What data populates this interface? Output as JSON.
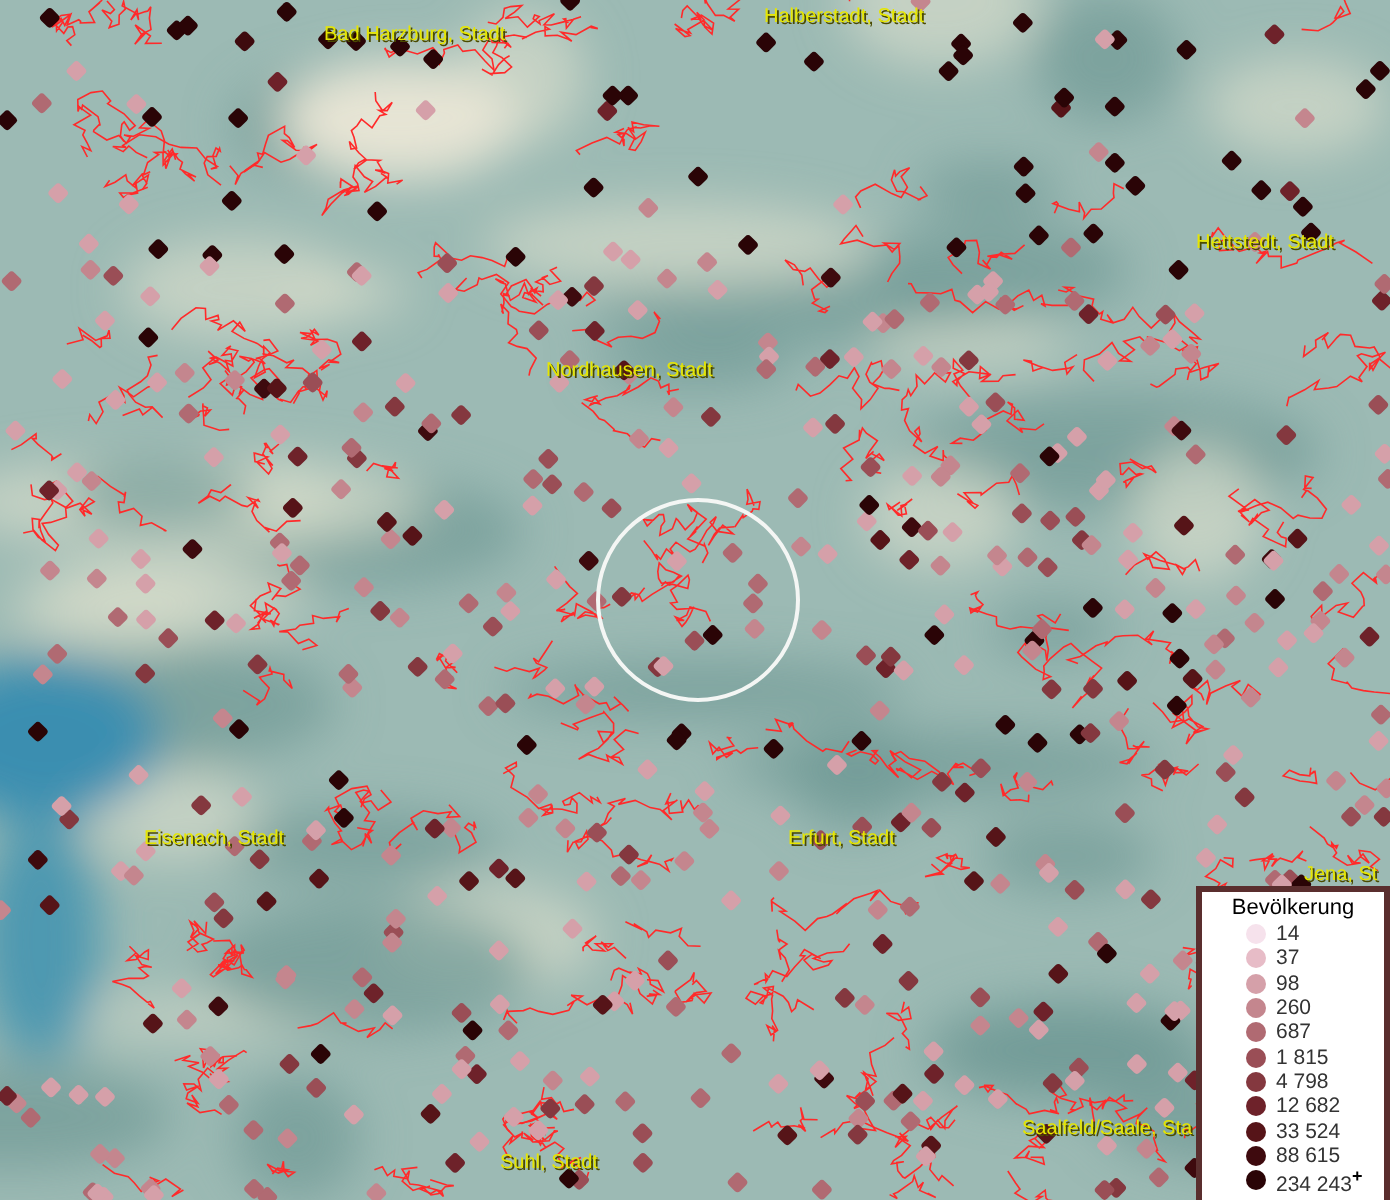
{
  "places": [
    {
      "name": "Bad Harzburg, Stadt"
    },
    {
      "name": "Halberstadt, Stadt"
    },
    {
      "name": "Hettstedt, Stadt"
    },
    {
      "name": "Nordhausen, Stadt"
    },
    {
      "name": "Eisenach, Stadt"
    },
    {
      "name": "Erfurt, Stadt"
    },
    {
      "name": "Jena, St"
    },
    {
      "name": "Saalfeld/Saale, Sta"
    },
    {
      "name": "Suhl, Stadt"
    }
  ],
  "legend": {
    "title": "Bevölkerung",
    "items": [
      {
        "label": "14",
        "color": "#f6e2ec"
      },
      {
        "label": "37",
        "color": "#e7bcc7"
      },
      {
        "label": "98",
        "color": "#d5a0a9"
      },
      {
        "label": "260",
        "color": "#c4868e"
      },
      {
        "label": "687",
        "color": "#b06a72"
      },
      {
        "label": "1 815",
        "color": "#9a4e56"
      },
      {
        "label": "4 798",
        "color": "#84383f"
      },
      {
        "label": "12 682",
        "color": "#6e222a"
      },
      {
        "label": "33 524",
        "color": "#561418"
      },
      {
        "label": "88 615",
        "color": "#3e0a0e"
      },
      {
        "label": "234 243$^{+}$",
        "color": "#2a0406"
      }
    ]
  }
}
